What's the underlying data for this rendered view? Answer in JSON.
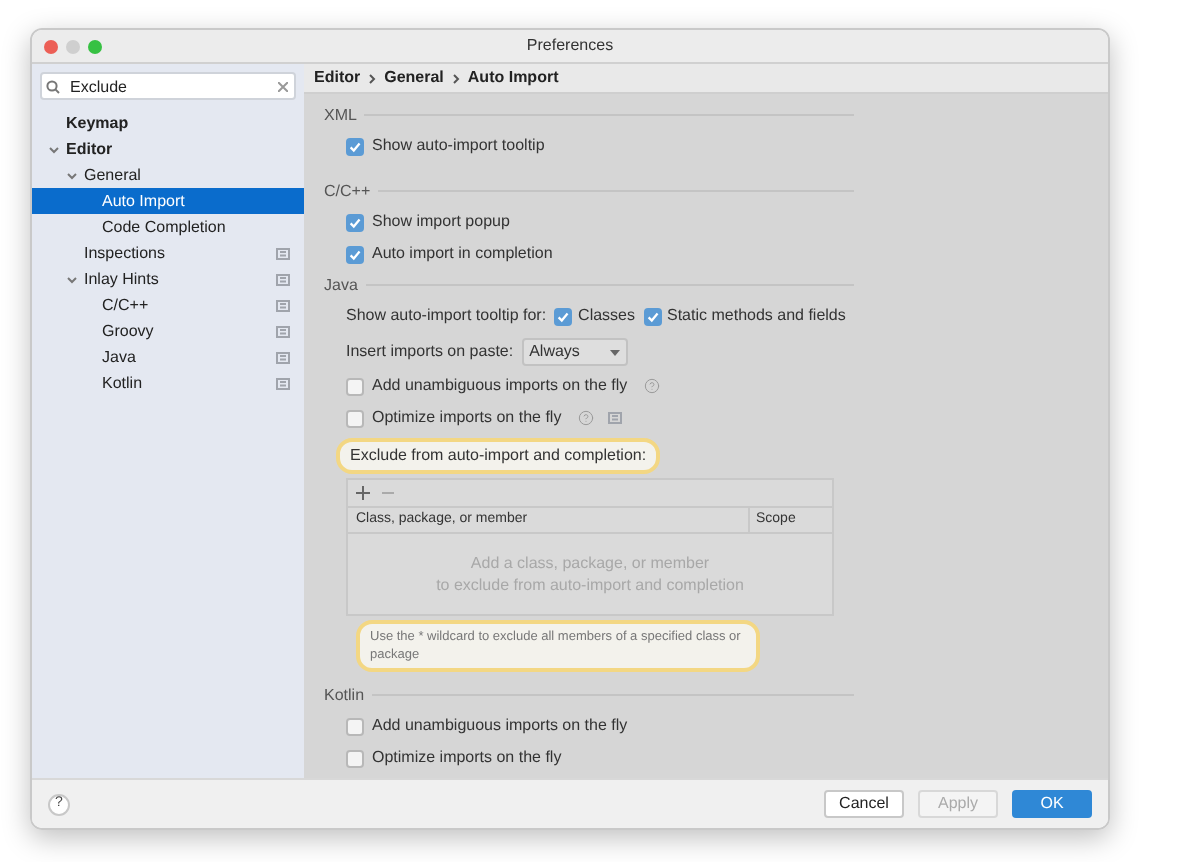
{
  "window": {
    "title": "Preferences"
  },
  "search": {
    "value": "Exclude"
  },
  "tree": [
    {
      "label": "Keymap",
      "bold": true,
      "selected": false,
      "badge_icon": false
    },
    {
      "label": "Editor",
      "bold": true,
      "selected": false,
      "badge_icon": false,
      "expanded": true,
      "children": [
        {
          "label": "General",
          "bold": false,
          "selected": false,
          "badge_icon": false,
          "expanded": true,
          "children": [
            {
              "label": "Auto Import",
              "bold": false,
              "selected": true,
              "badge_icon": false
            },
            {
              "label": "Code Completion",
              "bold": false,
              "selected": false,
              "badge_icon": false
            }
          ]
        },
        {
          "label": "Inspections",
          "bold": false,
          "selected": false,
          "badge_icon": true
        },
        {
          "label": "Inlay Hints",
          "bold": false,
          "selected": false,
          "badge_icon": true,
          "expanded": true,
          "children": [
            {
              "label": "C/C++",
              "bold": false,
              "selected": false,
              "badge_icon": true
            },
            {
              "label": "Groovy",
              "bold": false,
              "selected": false,
              "badge_icon": true
            },
            {
              "label": "Java",
              "bold": false,
              "selected": false,
              "badge_icon": true
            },
            {
              "label": "Kotlin",
              "bold": false,
              "selected": false,
              "badge_icon": true
            }
          ]
        }
      ]
    }
  ],
  "breadcrumb": [
    "Editor",
    "General",
    "Auto Import"
  ],
  "sections": [
    {
      "title": "XML",
      "items": [
        {
          "kind": "checkbox",
          "label": "Show auto-import tooltip",
          "checked": true
        }
      ]
    },
    {
      "title": "C/C++",
      "items": [
        {
          "kind": "checkbox",
          "label": "Show import popup",
          "checked": true
        },
        {
          "kind": "checkbox",
          "label": "Auto import in completion",
          "checked": true
        }
      ]
    },
    {
      "title": "Java",
      "items": [
        {
          "kind": "checkgroup",
          "label": "Show auto-import tooltip for:",
          "options": [
            {
              "label": "Classes",
              "checked": true
            },
            {
              "label": "Static methods and fields",
              "checked": true
            }
          ]
        },
        {
          "kind": "select",
          "label": "Insert imports on paste:",
          "value": "Always"
        },
        {
          "kind": "checkbox",
          "label": "Add unambiguous imports on the fly",
          "checked": false,
          "help": true
        },
        {
          "kind": "checkbox",
          "label": "Optimize imports on the fly",
          "checked": false,
          "help": true,
          "settings": true
        },
        {
          "kind": "table",
          "label": "Exclude from auto-import and completion:",
          "highlighted": true,
          "columns": [
            "Class, package, or member",
            "Scope"
          ],
          "empty_text": [
            "Add a class, package, or member",
            "to exclude from auto-import and completion"
          ],
          "hint": "Use the * wildcard to exclude all members of a specified class or package",
          "hint_highlighted": true
        }
      ]
    },
    {
      "title": "Kotlin",
      "items": [
        {
          "kind": "checkbox",
          "label": "Add unambiguous imports on the fly",
          "checked": false
        },
        {
          "kind": "checkbox",
          "label": "Optimize imports on the fly",
          "checked": false
        }
      ]
    }
  ],
  "help_button": "?",
  "buttons": [
    {
      "label": "Cancel",
      "primary": false,
      "disabled": false
    },
    {
      "label": "Apply",
      "primary": false,
      "disabled": true
    },
    {
      "label": "OK",
      "primary": true,
      "disabled": false
    }
  ]
}
